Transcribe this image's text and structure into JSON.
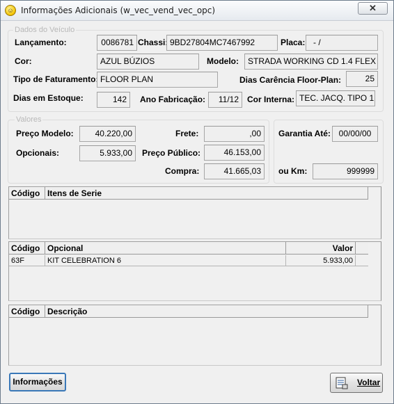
{
  "window": {
    "title": "Informações Adicionais (w_vec_vend_vec_opc)",
    "close_symbol": "✕"
  },
  "dados_veiculo": {
    "legend": "Dados do Veículo",
    "lancamento": {
      "label": "Lançamento:",
      "value": "0086781"
    },
    "chassi": {
      "label": "Chassi:",
      "value": "9BD27804MC7467992"
    },
    "placa": {
      "label": "Placa:",
      "value": "-   /"
    },
    "cor": {
      "label": "Cor:",
      "value": "AZUL BÚZIOS"
    },
    "modelo": {
      "label": "Modelo:",
      "value": "STRADA WORKING CD 1.4 FLEX"
    },
    "tipo_faturamento": {
      "label": "Tipo de Faturamento:",
      "value": "FLOOR PLAN"
    },
    "dias_carencia": {
      "label": "Dias Carência Floor-Plan:",
      "value": "25"
    },
    "dias_estoque": {
      "label": "Dias em Estoque:",
      "value": "142"
    },
    "ano_fabricacao": {
      "label": "Ano Fabricação:",
      "value": "11/12"
    },
    "cor_interna": {
      "label": "Cor Interna:",
      "value": "TEC. JACQ. TIPO 1"
    }
  },
  "valores": {
    "legend": "Valores",
    "preco_modelo": {
      "label": "Preço Modelo:",
      "value": "40.220,00"
    },
    "opcionais": {
      "label": "Opcionais:",
      "value": "5.933,00"
    },
    "frete": {
      "label": "Frete:",
      "value": ",00"
    },
    "preco_publico": {
      "label": "Preço Público:",
      "value": "46.153,00"
    },
    "compra": {
      "label": "Compra:",
      "value": "41.665,03"
    }
  },
  "garantia": {
    "garantia_ate": {
      "label": "Garantia Até:",
      "value": "00/00/00"
    },
    "ou_km": {
      "label": "ou Km:",
      "value": "999999"
    }
  },
  "itens_serie": {
    "columns": [
      "Código",
      "Itens de Serie"
    ],
    "rows": []
  },
  "opcionais_grid": {
    "columns": [
      "Código",
      "Opcional",
      "Valor"
    ],
    "rows": [
      {
        "codigo": "63F",
        "opcional": "KIT CELEBRATION 6",
        "valor": "5.933,00"
      }
    ]
  },
  "descricao_grid": {
    "columns": [
      "Código",
      "Descrição"
    ],
    "rows": []
  },
  "buttons": {
    "informacoes": "Informações",
    "voltar": "Voltar"
  },
  "icons": {
    "app": "smiley-icon",
    "voltar": "document-list-icon"
  }
}
